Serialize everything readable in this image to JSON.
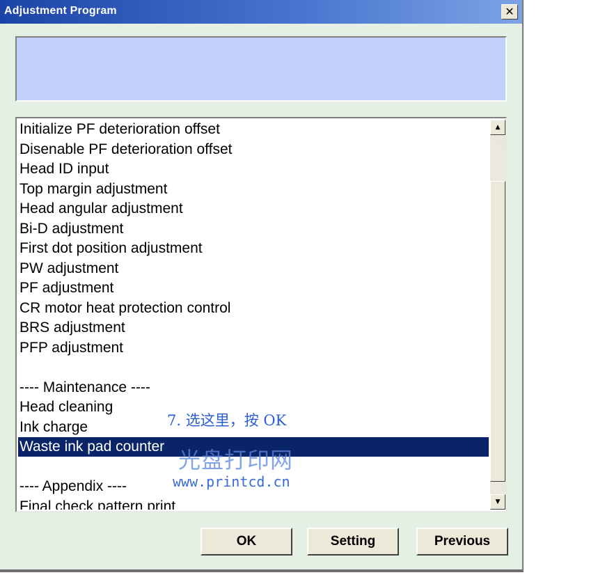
{
  "window": {
    "title": "Adjustment Program",
    "close_glyph": "✕"
  },
  "message_panel": {
    "text": ""
  },
  "list": {
    "items": [
      "Initialize PF deterioration offset",
      "Disenable PF deterioration offset",
      "Head ID input",
      "Top margin adjustment",
      "Head angular adjustment",
      "Bi-D adjustment",
      "First dot position adjustment",
      "PW adjustment",
      "PF adjustment",
      "CR motor heat protection control",
      "BRS adjustment",
      "PFP adjustment",
      "",
      "---- Maintenance ----",
      "Head cleaning",
      "Ink charge",
      "Waste ink pad counter",
      "",
      "---- Appendix ----",
      "Final check pattern print"
    ],
    "selected_index": 16
  },
  "scrollbar": {
    "up_glyph": "▲",
    "down_glyph": "▼"
  },
  "annotations": {
    "instruction": "7. 选这里，按 OK",
    "logo": "光盘打印网",
    "url": "www.printcd.cn"
  },
  "buttons": {
    "ok": "OK",
    "setting": "Setting",
    "previous": "Previous"
  },
  "colors": {
    "title_bar": "#1c44a8",
    "message_panel": "#c2d0fc",
    "selection": "#0a246a",
    "annotation": "#2a5dd6"
  },
  "icons": {
    "close": "close-icon",
    "scroll_up": "arrow-up-icon",
    "scroll_down": "arrow-down-icon"
  }
}
